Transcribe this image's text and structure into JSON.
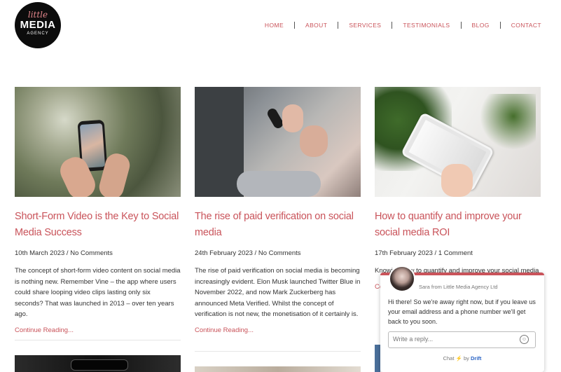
{
  "logo": {
    "line1": "little",
    "line2": "MEDIA",
    "line3": "AGENCY"
  },
  "nav": {
    "items": [
      "HOME",
      "ABOUT",
      "SERVICES",
      "TESTIMONIALS",
      "BLOG",
      "CONTACT"
    ]
  },
  "posts": [
    {
      "title": "Short-Form Video is the Key to Social Media Success",
      "date": "10th March 2023",
      "comments": "No Comments",
      "excerpt": "The concept of short-form video content on social media is nothing new. Remember Vine – the app where users could share looping video clips lasting only six seconds? That was launched in 2013 – over ten years ago.",
      "more": "Continue Reading..."
    },
    {
      "title": "The rise of paid verification on social media",
      "date": "24th February 2023",
      "comments": "No Comments",
      "excerpt": "The rise of paid verification on social media is becoming increasingly evident. Elon Musk launched Twitter Blue in November 2022, and now Mark Zuckerberg has announced Meta Verified. Whilst the concept of verification is not new, the monetisation of it certainly is.",
      "more": "Continue Reading..."
    },
    {
      "title": "How to quantify and improve your social media ROI",
      "date": "17th February 2023",
      "comments": "1 Comment",
      "excerpt": "Knowing how to quantify and improve your social media",
      "more": "Co"
    }
  ],
  "chat": {
    "from": "Sara from Little Media Agency Ltd",
    "message": "Hi there! So we're away right now, but if you leave us your email address and a phone number we'll get back to you soon.",
    "placeholder": "Write a reply...",
    "footer_chat": "Chat",
    "footer_by": "by",
    "footer_brand": "Drift"
  },
  "colors": {
    "accent": "#c9535a",
    "drift": "#2a64c5"
  }
}
